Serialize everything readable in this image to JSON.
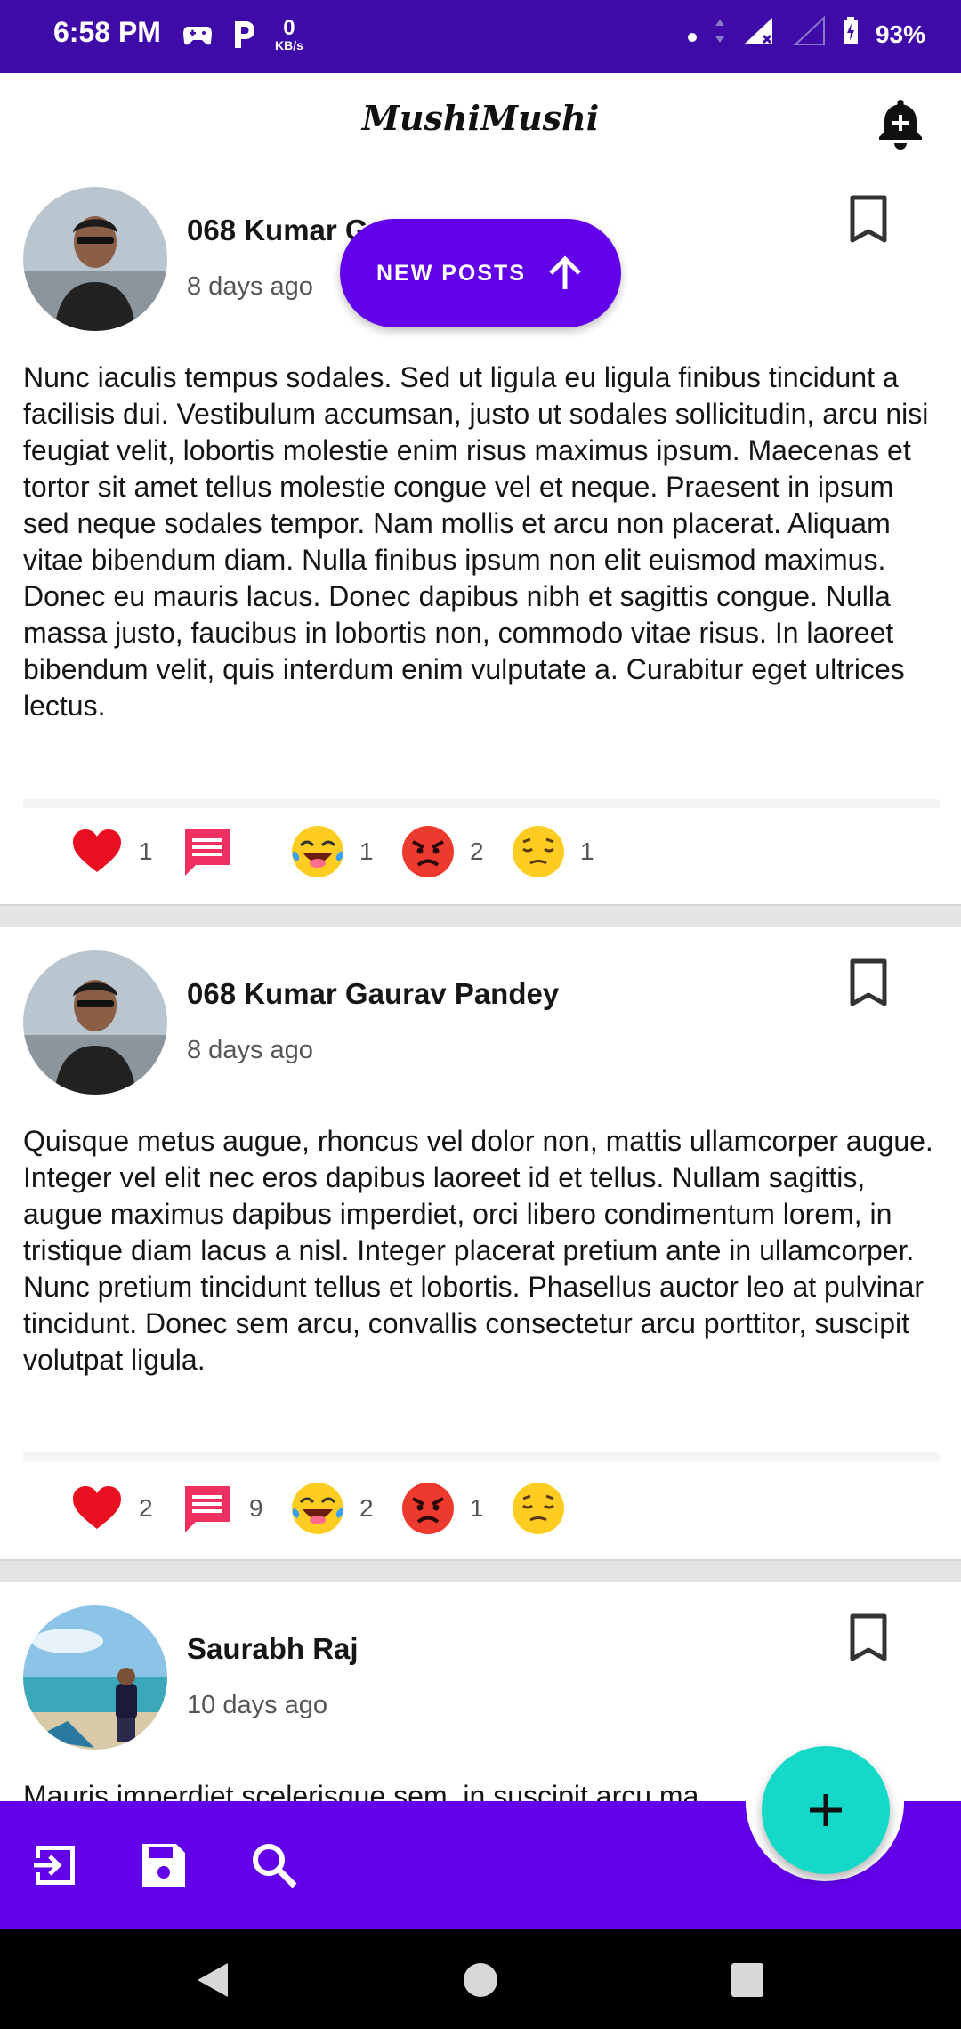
{
  "status_bar": {
    "time": "6:58 PM",
    "speed_value": "0",
    "speed_unit": "KB/s",
    "battery": "93%"
  },
  "app_bar": {
    "title": "MushiMushi",
    "bell_icon": "notification-add-icon"
  },
  "new_posts_button": {
    "label": "NEW POSTS",
    "icon": "arrow-up-icon"
  },
  "posts": [
    {
      "author": "068 Kumar Gaurav Pandey",
      "time": "8 days ago",
      "body": "Nunc iaculis tempus sodales. Sed ut ligula eu ligula finibus tincidunt a facilisis dui. Vestibulum accumsan, justo ut sodales sollicitudin, arcu nisi feugiat velit, lobortis molestie enim risus maximus ipsum. Maecenas et tortor sit amet tellus molestie congue vel et neque. Praesent in ipsum sed neque sodales tempor. Nam mollis et arcu non placerat. Aliquam vitae bibendum diam. Nulla finibus ipsum non elit euismod maximus. Donec eu mauris lacus. Donec dapibus nibh et sagittis congue. Nulla massa justo, faucibus in lobortis non, commodo vitae risus. In laoreet bibendum velit, quis interdum enim vulputate a. Curabitur eget ultrices lectus.",
      "reactions": {
        "like": "1",
        "comments": "",
        "laugh": "1",
        "angry": "2",
        "sad": "1"
      }
    },
    {
      "author": "068 Kumar Gaurav Pandey",
      "time": "8 days ago",
      "body": "Quisque metus augue, rhoncus vel dolor non, mattis ullamcorper augue. Integer vel elit nec eros dapibus laoreet id et tellus. Nullam sagittis, augue maximus dapibus imperdiet, orci libero condimentum lorem, in tristique diam lacus a nisl. Integer placerat pretium ante in ullamcorper. Nunc pretium tincidunt tellus et lobortis. Phasellus auctor leo at pulvinar tincidunt. Donec sem arcu, convallis consectetur arcu porttitor, suscipit volutpat ligula.",
      "reactions": {
        "like": "2",
        "comments": "9",
        "laugh": "2",
        "angry": "1",
        "sad": ""
      }
    },
    {
      "author": "Saurabh Raj",
      "time": "10 days ago",
      "body": "Mauris imperdiet scelerisque sem, in suscipit arcu ma"
    }
  ],
  "bottom_bar": {
    "icons": [
      "logout-icon",
      "save-icon",
      "search-icon"
    ],
    "fab_icon": "add-icon"
  },
  "colors": {
    "status_bar": "#3e0aa8",
    "primary": "#6200ea",
    "fab": "#14d8c8",
    "like": "#e81020",
    "comment": "#f03060"
  }
}
